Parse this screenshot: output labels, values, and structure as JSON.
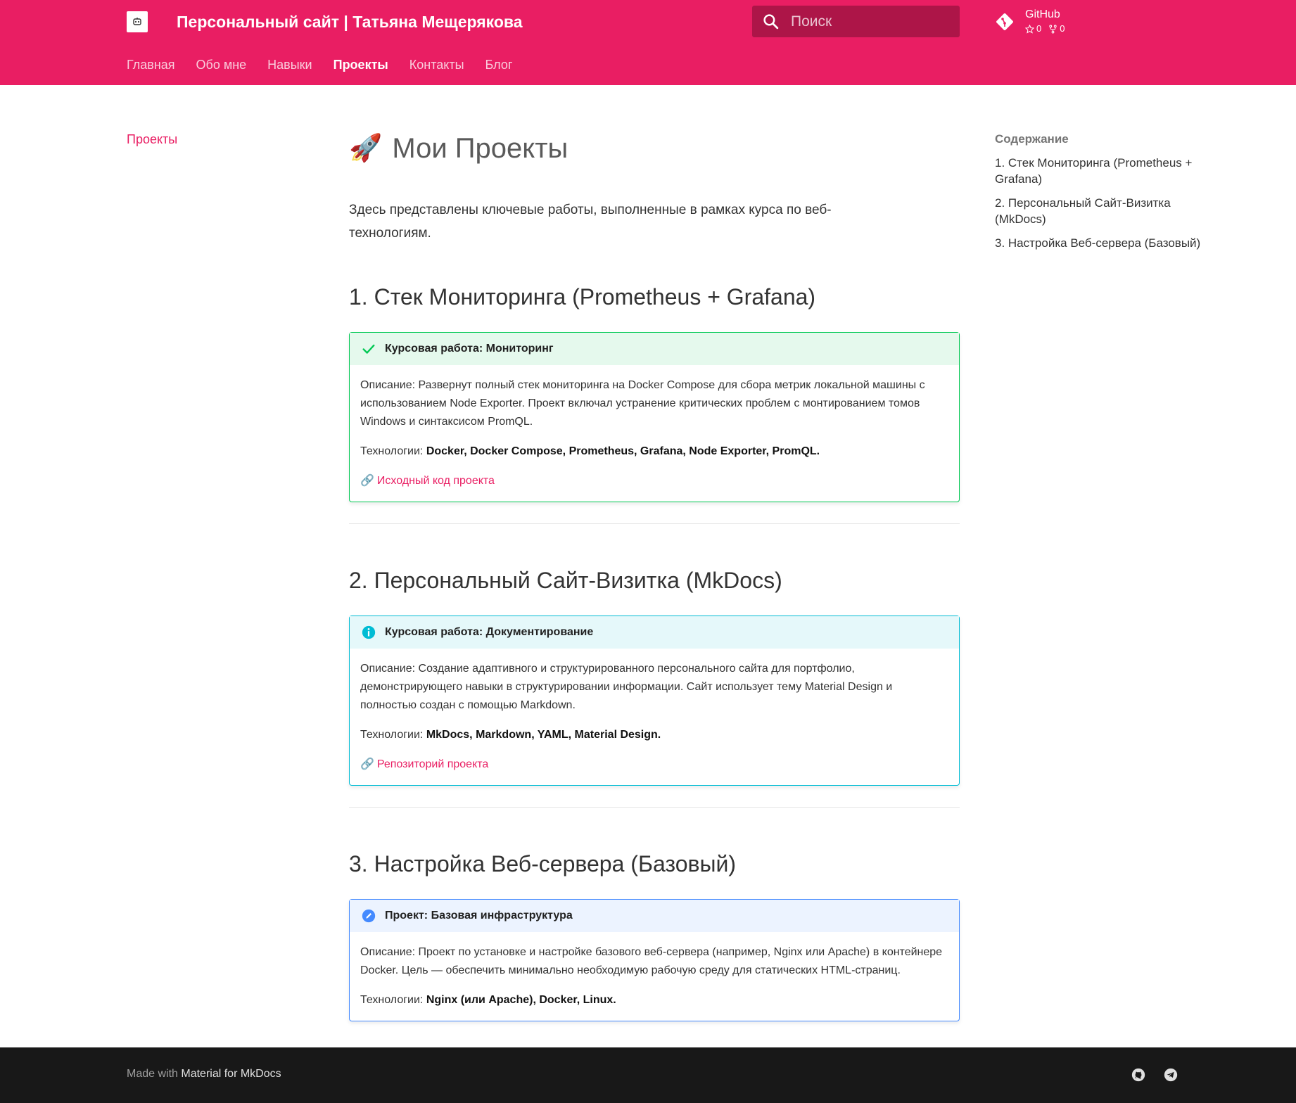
{
  "header": {
    "site_title": "Персональный сайт | Татьяна Мещерякова",
    "search_placeholder": "Поиск",
    "repo": {
      "name": "GitHub",
      "stars": "0",
      "forks": "0"
    }
  },
  "tabs": [
    {
      "label": "Главная"
    },
    {
      "label": "Обо мне"
    },
    {
      "label": "Навыки"
    },
    {
      "label": "Проекты",
      "active": true
    },
    {
      "label": "Контакты"
    },
    {
      "label": "Блог"
    }
  ],
  "left_nav": {
    "item": "Проекты"
  },
  "main": {
    "title_emoji": "🚀",
    "title": "Мои Проекты",
    "intro": "Здесь представлены ключевые работы, выполненные в рамках курса по веб-технологиям.",
    "sections": [
      {
        "heading": "1. Стек Мониторинга (Prometheus + Grafana)",
        "admonition": {
          "type": "success",
          "title": "Курсовая работа: Мониторинг",
          "description": "Описание: Развернут полный стек мониторинга на Docker Compose для сбора метрик локальной машины с использованием Node Exporter. Проект включал устранение критических проблем с монтированием томов Windows и синтаксисом PromQL.",
          "tech_label": "Технологии: ",
          "tech": "Docker, Docker Compose, Prometheus, Grafana, Node Exporter, PromQL.",
          "link_icon": "🔗",
          "link": "Исходный код проекта"
        }
      },
      {
        "heading": "2. Персональный Сайт-Визитка (MkDocs)",
        "admonition": {
          "type": "info",
          "title": "Курсовая работа: Документирование",
          "description": "Описание: Создание адаптивного и структурированного персонального сайта для портфолио, демонстрирующего навыки в структурировании информации. Сайт использует тему Material Design и полностью создан с помощью Markdown.",
          "tech_label": "Технологии: ",
          "tech": "MkDocs, Markdown, YAML, Material Design.",
          "link_icon": "🔗",
          "link": "Репозиторий проекта"
        }
      },
      {
        "heading": "3. Настройка Веб-сервера (Базовый)",
        "admonition": {
          "type": "note",
          "title": "Проект: Базовая инфраструктура",
          "description": "Описание: Проект по установке и настройке базового веб-сервера (например, Nginx или Apache) в контейнере Docker. Цель — обеспечить минимально необходимую рабочую среду для статических HTML-страниц.",
          "tech_label": "Технологии: ",
          "tech": "Nginx (или Apache), Docker, Linux."
        }
      }
    ]
  },
  "toc": {
    "title": "Содержание",
    "items": [
      "1. Стек Мониторинга (Prometheus + Grafana)",
      "2. Персональный Сайт-Визитка (MkDocs)",
      "3. Настройка Веб-сервера (Базовый)"
    ]
  },
  "footer": {
    "made_with": "Made with",
    "theme_link": "Material for MkDocs",
    "social": [
      "github-icon",
      "telegram-icon"
    ]
  },
  "colors": {
    "primary": "#e91e63",
    "search_bg": "#ad1548",
    "success": "#00c853",
    "info": "#00bcd4",
    "note": "#448aff",
    "footer_bg": "#181818"
  }
}
